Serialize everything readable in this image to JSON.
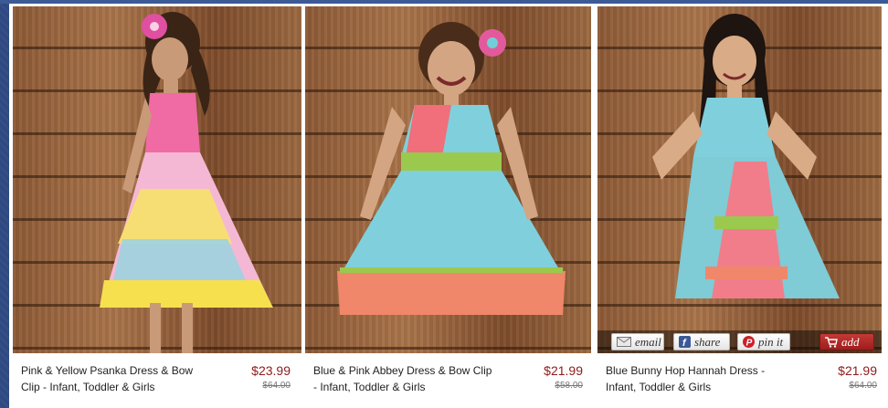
{
  "products": [
    {
      "title": "Pink & Yellow Psanka Dress & Bow Clip - Infant, Toddler & Girls",
      "price": "$23.99",
      "old_price": "$64.00",
      "image_alt": "Girl in pink and yellow patchwork dress with pink bow"
    },
    {
      "title": "Blue & Pink Abbey Dress & Bow Clip - Infant, Toddler & Girls",
      "price": "$21.99",
      "old_price": "$58.00",
      "image_alt": "Smiling girl in blue and pink dress with flower bow"
    },
    {
      "title": "Blue Bunny Hop Hannah Dress - Infant, Toddler & Girls",
      "price": "$21.99",
      "old_price": "$64.00",
      "image_alt": "Girl in blue bunny print dress with hands on hips"
    }
  ],
  "actions": {
    "email_label": "email",
    "share_label": "share",
    "pin_label": "pin it",
    "add_label": "add"
  },
  "colors": {
    "price": "#8e1a1a",
    "add_button": "#b02a28",
    "page_background": "#2f4a82"
  }
}
